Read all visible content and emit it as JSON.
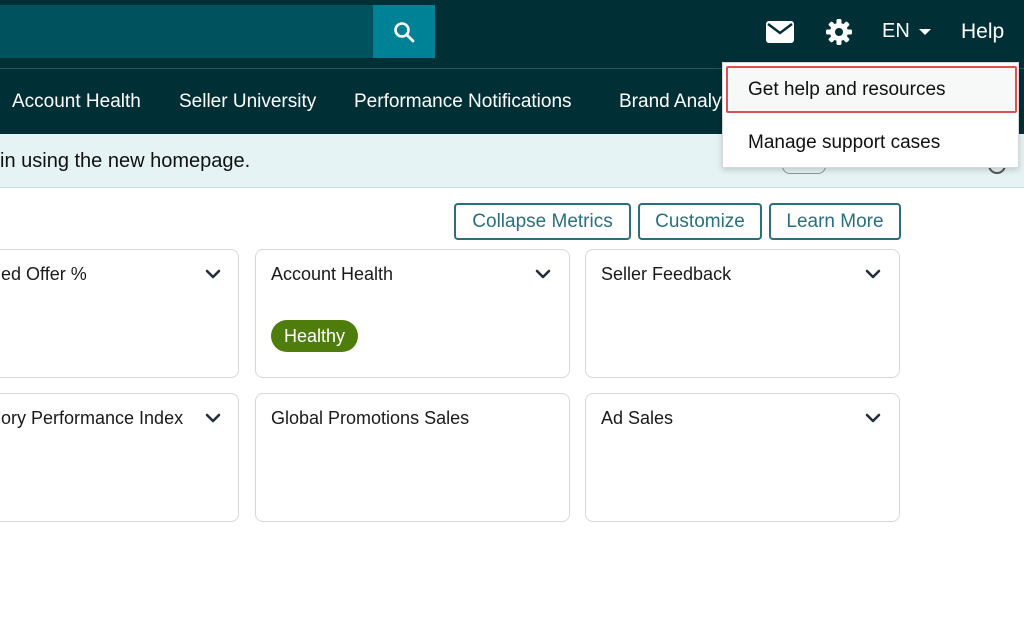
{
  "topbar": {
    "search": {
      "value": "",
      "placeholder": ""
    },
    "icons": {
      "search": "search-icon",
      "mail": "mail-icon",
      "settings": "gear-icon",
      "caret": "caret-down-icon"
    },
    "language": "EN",
    "help": "Help"
  },
  "nav": {
    "items": [
      {
        "label": "Account Health"
      },
      {
        "label": "Seller University"
      },
      {
        "label": "Performance Notifications"
      },
      {
        "label": "Brand Analytics"
      }
    ]
  },
  "banner": {
    "text": "in using the new homepage."
  },
  "actions": {
    "collapse": "Collapse Metrics",
    "customize": "Customize",
    "learn_more": "Learn More"
  },
  "cards": [
    {
      "title": "ed Offer %"
    },
    {
      "title": "Account Health",
      "badge": "Healthy"
    },
    {
      "title": "Seller Feedback"
    },
    {
      "title": "ory Performance Index"
    },
    {
      "title": "Global Promotions Sales"
    },
    {
      "title": "Ad Sales"
    }
  ],
  "help_menu": {
    "items": [
      {
        "label": "Get help and resources",
        "highlighted": true
      },
      {
        "label": "Manage support cases"
      }
    ]
  },
  "colors": {
    "topbar": "#002f36",
    "search_field": "#00525e",
    "search_button": "#008296",
    "banner": "#e6f3f5",
    "accent": "#2a6f7d",
    "healthy": "#4e7d0b",
    "highlight_border": "#d9534f"
  }
}
